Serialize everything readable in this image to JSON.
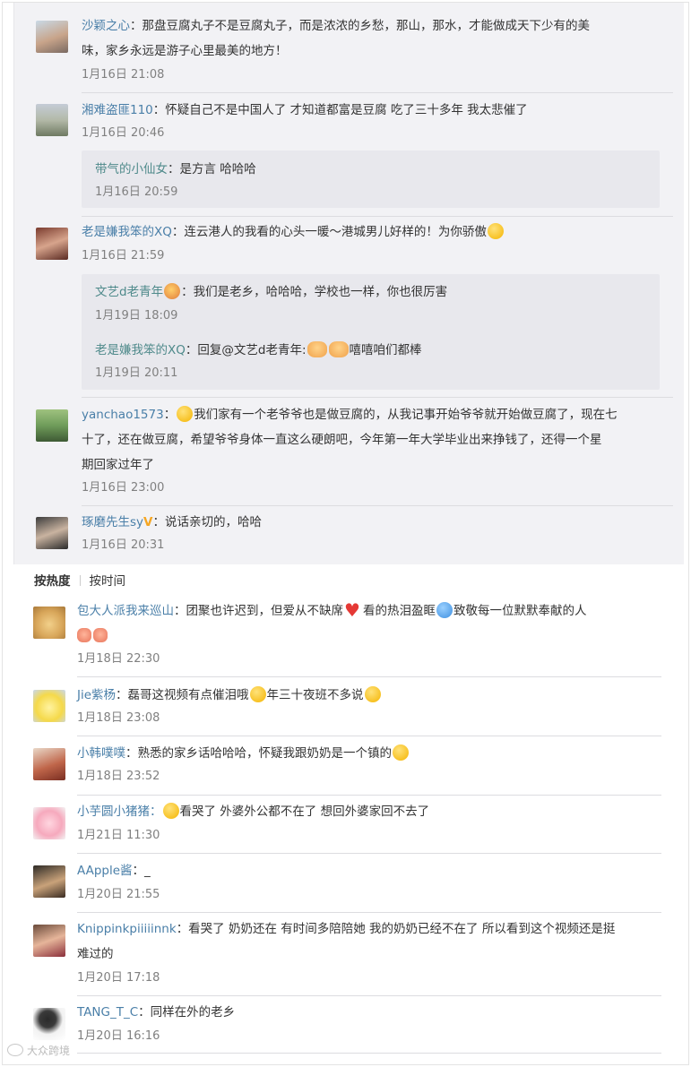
{
  "replies": [
    {
      "user": "沙颖之心",
      "text_line1": "：那盘豆腐丸子不是豆腐丸子，而是浓浓的乡愁，那山，那水，才能做成天下少有的美",
      "text_line2": "味，家乡永远是游子心里最美的地方！",
      "time": "1月16日 21:08"
    },
    {
      "user": "湘难盗匪110",
      "text": "：怀疑自己不是中国人了 才知道都富是豆腐 吃了三十多年 我太悲催了",
      "time": "1月16日 20:46",
      "nested": [
        {
          "user": "带气的小仙女",
          "text": "：是方言 哈哈哈",
          "time": "1月16日 20:59"
        }
      ]
    },
    {
      "user": "老是嫌我笨的XQ",
      "text": "：连云港人的我看的心头一暖～港城男儿好样的！为你骄傲",
      "time": "1月16日 21:59",
      "nested": [
        {
          "user": "文艺d老青年",
          "text": "：我们是老乡，哈哈哈，学校也一样，你也很厉害",
          "time": "1月19日 18:09"
        },
        {
          "user": "老是嫌我笨的XQ",
          "text": "：回复@文艺d老青年:",
          "text_after": "嘻嘻咱们都棒",
          "time": "1月19日 20:11"
        }
      ]
    },
    {
      "user": "yanchao1573",
      "text_line1": "：",
      "text_line1b": "我们家有一个老爷爷也是做豆腐的，从我记事开始爷爷就开始做豆腐了，现在七",
      "text_line2": "十了，还在做豆腐，希望爷爷身体一直这么硬朗吧，今年第一年大学毕业出来挣钱了，还得一个星",
      "text_line3": "期回家过年了",
      "time": "1月16日 23:00"
    },
    {
      "user": "琢磨先生sy",
      "badge": "V",
      "text": "：说话亲切的，哈哈",
      "time": "1月16日 20:31"
    }
  ],
  "tabs": {
    "hot": "按热度",
    "time": "按时间"
  },
  "comments": [
    {
      "user": "包大人派我来巡山",
      "text_a": "：团聚也许迟到，但爱从不缺席",
      "text_b": "看的热泪盈眶",
      "text_c": "致敬每一位默默奉献的人",
      "time": "1月18日 22:30"
    },
    {
      "user": "Jie紫杨",
      "text_a": "：磊哥这视频有点催泪哦",
      "text_b": "年三十夜班不多说",
      "time": "1月18日 23:08"
    },
    {
      "user": "小韩噗噗",
      "text": "：熟悉的家乡话哈哈哈，怀疑我跟奶奶是一个镇的",
      "time": "1月18日 23:52"
    },
    {
      "user": "小芋圆小猪猪",
      "text": "看哭了 外婆外公都不在了 想回外婆家回不去了",
      "time": "1月21日 11:30"
    },
    {
      "user": "AApple酱",
      "text": "：_",
      "time": "1月20日 21:55"
    },
    {
      "user": "Knippinkpiiiiinnk",
      "text_line1": "：看哭了 奶奶还在 有时间多陪陪她 我的奶奶已经不在了 所以看到这个视频还是挺",
      "text_line2": "难过的",
      "time": "1月20日 17:18"
    },
    {
      "user": "TANG_T_C",
      "text": "：同样在外的老乡",
      "time": "1月20日 16:16"
    }
  ],
  "watermark": "大众跨境",
  "colors": {
    "username": "#4a7fa8",
    "nested_username": "#4f8a8b",
    "time": "#808080",
    "upper_bg": "#f2f2f5"
  },
  "icons": [
    "avatar",
    "emoji-face",
    "heart-icon",
    "v-badge-icon",
    "fist-bump-icon",
    "logo-icon"
  ]
}
